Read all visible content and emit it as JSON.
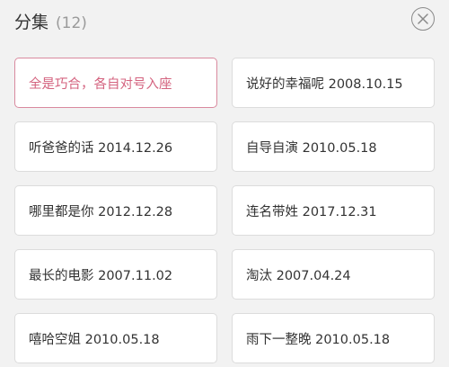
{
  "header": {
    "title": "分集",
    "count": "(12)"
  },
  "episodes": [
    {
      "label": "全是巧合，各自对号入座",
      "selected": true
    },
    {
      "label": "说好的幸福呢  2008.10.15"
    },
    {
      "label": "听爸爸的话  2014.12.26"
    },
    {
      "label": "自导自演  2010.05.18"
    },
    {
      "label": "哪里都是你  2012.12.28"
    },
    {
      "label": "连名带姓  2017.12.31"
    },
    {
      "label": "最长的电影  2007.11.02"
    },
    {
      "label": "淘汰  2007.04.24"
    },
    {
      "label": "嘻哈空姐  2010.05.18"
    },
    {
      "label": "雨下一整晚  2010.05.18"
    }
  ],
  "colors": {
    "selected_accent": "#d4637f",
    "background": "#f2f2f2"
  },
  "icons": {
    "close": "close-icon"
  }
}
